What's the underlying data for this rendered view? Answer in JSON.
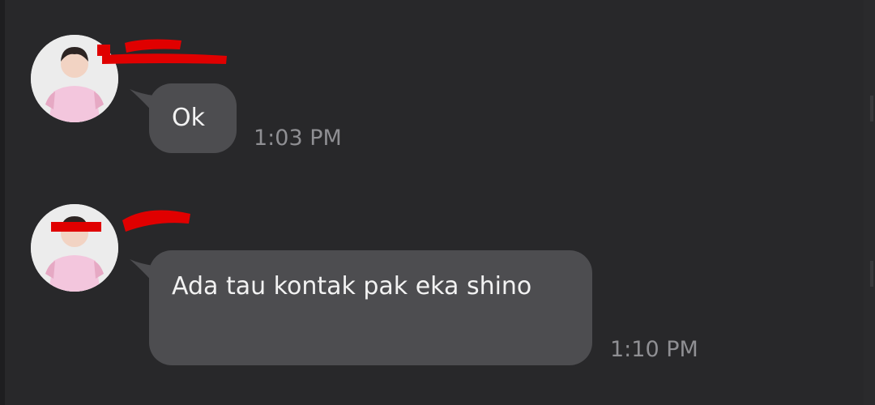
{
  "messages": [
    {
      "text": "Ok",
      "time": "1:03 PM"
    },
    {
      "text": "Ada tau kontak pak eka shino",
      "time": "1:10 PM"
    }
  ],
  "colors": {
    "background": "#28282a",
    "bubble": "#4d4d50",
    "bubble_text": "#f2f2f2",
    "timestamp": "#8f8f93",
    "redaction": "#e00000"
  },
  "icons": [
    "avatar",
    "redaction-mark"
  ]
}
